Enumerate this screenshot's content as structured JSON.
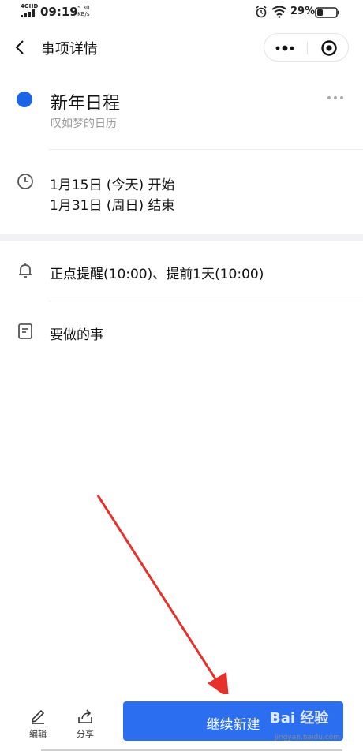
{
  "status_bar": {
    "network": "4GHD",
    "time": "09:19",
    "speed_value": "5.30",
    "speed_unit": "KB/s",
    "battery_pct": "29%"
  },
  "header": {
    "title": "事项详情",
    "icons": [
      "back-arrow-icon",
      "more-dots-icon",
      "close-target-icon"
    ]
  },
  "event": {
    "title": "新年日程",
    "calendar": "叹如梦的日历",
    "color": "#1a66e6"
  },
  "time": {
    "start": "1月15日 (今天) 开始",
    "end": "1月31日 (周日) 结束"
  },
  "reminder": {
    "text": "正点提醒(10:00)、提前1天(10:00)"
  },
  "todo": {
    "label": "要做的事"
  },
  "bottom_bar": {
    "edit_label": "编辑",
    "share_label": "分享",
    "continue_label": "继续新建",
    "accent": "#2b6ff0"
  },
  "watermark": {
    "main": "Bai 经验",
    "sub": "jingyan.baidu.com"
  }
}
